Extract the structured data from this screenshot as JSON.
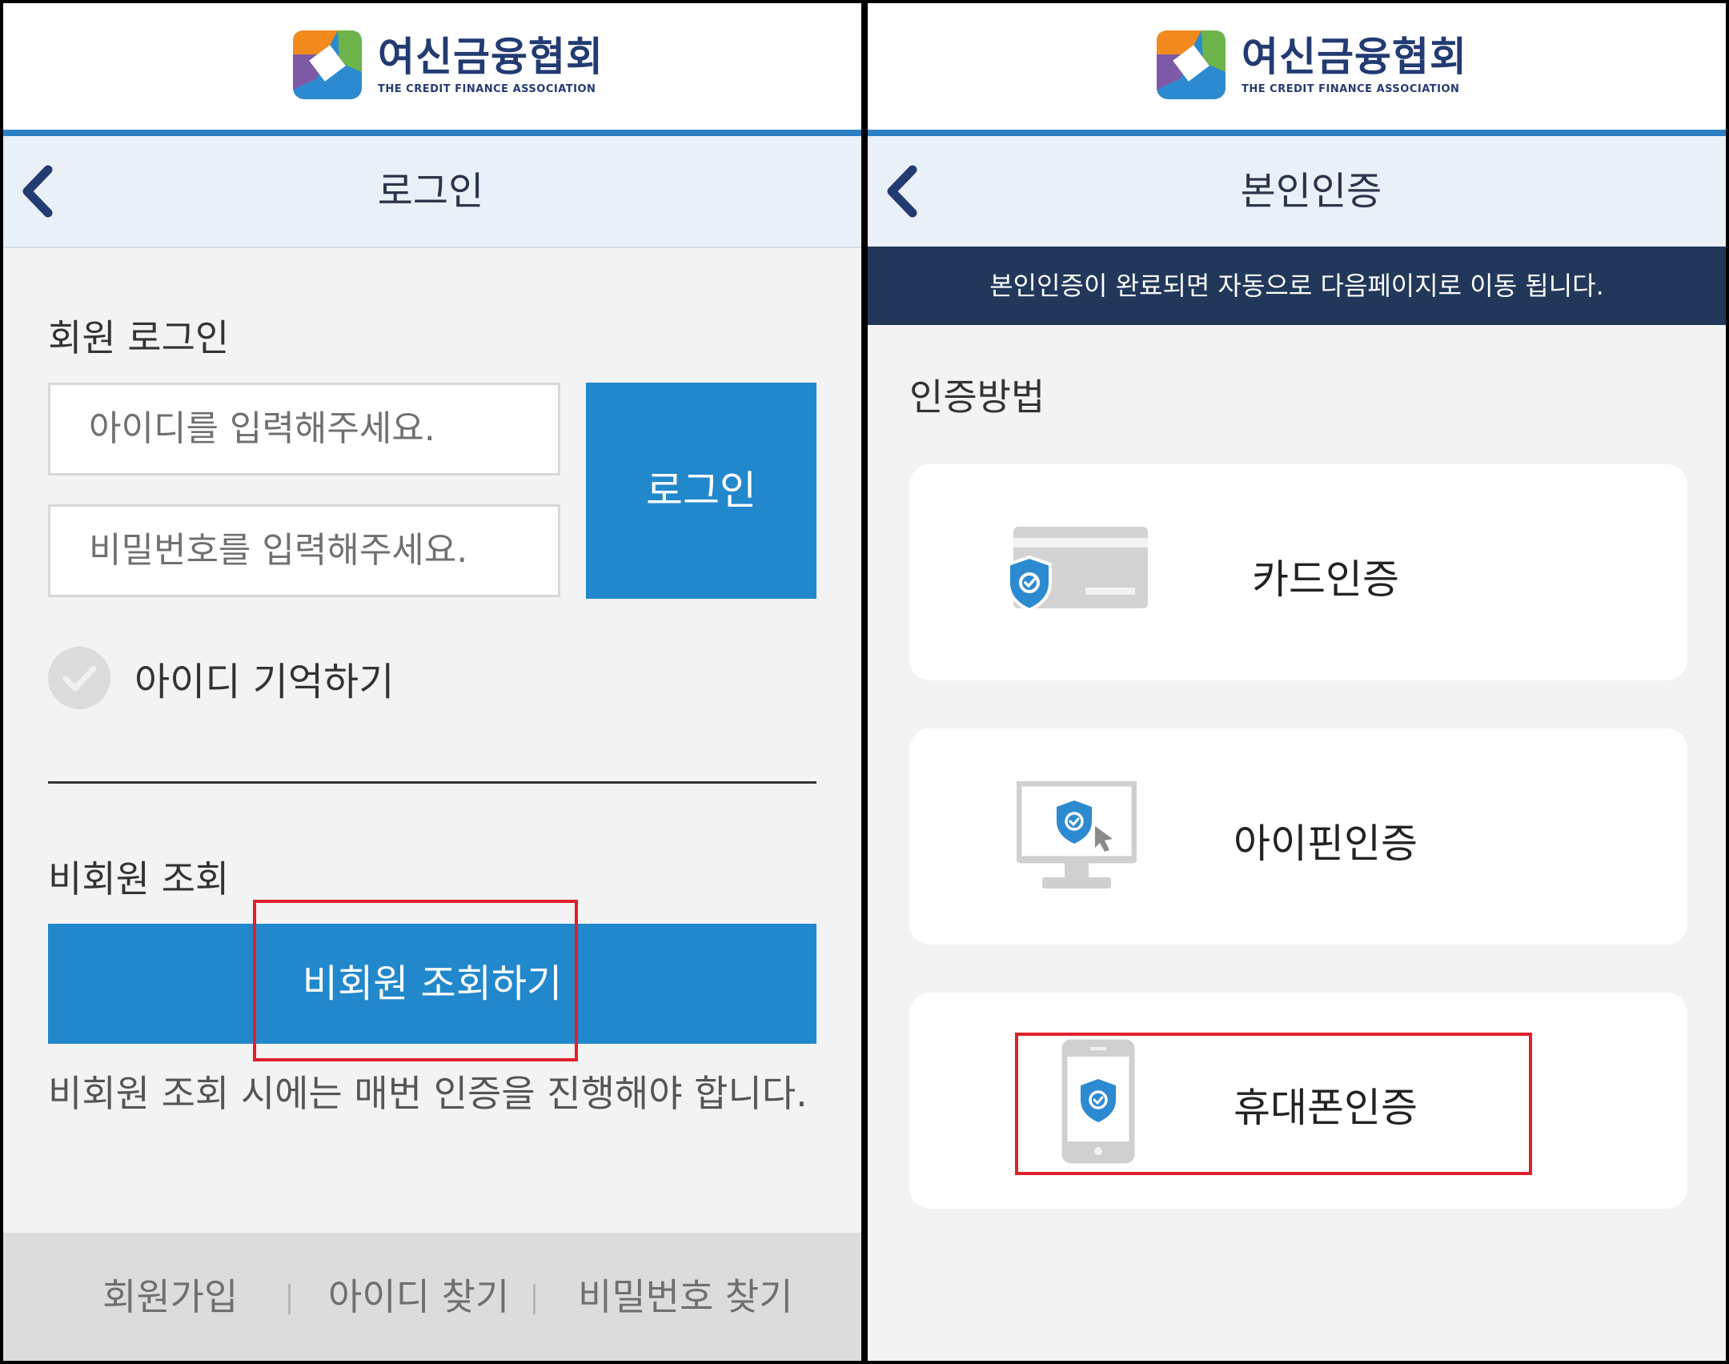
{
  "brand": {
    "name_ko": "여신금융협회",
    "name_en": "THE CREDIT FINANCE ASSOCIATION",
    "colors": {
      "orange": "#f28a1e",
      "green": "#6cb44a",
      "blue": "#2c8ad0",
      "purple": "#7d59a6",
      "navy": "#233b73"
    }
  },
  "login_screen": {
    "title": "로그인",
    "member_section_label": "회원 로그인",
    "id_placeholder": "아이디를 입력해주세요.",
    "password_placeholder": "비밀번호를 입력해주세요.",
    "login_button": "로그인",
    "remember_id_label": "아이디 기억하기",
    "remember_id_checked": false,
    "guest_section_label": "비회원 조회",
    "guest_button": "비회원 조회하기",
    "guest_note": "비회원 조회 시에는 매번 인증을 진행해야 합니다.",
    "footer_links": [
      "회원가입",
      "아이디 찾기",
      "비밀번호 찾기"
    ],
    "accent_color": "#2288cc"
  },
  "auth_screen": {
    "title": "본인인증",
    "notice": "본인인증이 완료되면 자동으로 다음페이지로 이동 됩니다.",
    "method_section_label": "인증방법",
    "methods": [
      {
        "label": "카드인증",
        "icon": "credit-card-shield-icon"
      },
      {
        "label": "아이핀인증",
        "icon": "monitor-shield-icon"
      },
      {
        "label": "휴대폰인증",
        "icon": "phone-shield-icon"
      }
    ],
    "notice_color": "#22385a"
  },
  "highlight_color": "#e0202a"
}
